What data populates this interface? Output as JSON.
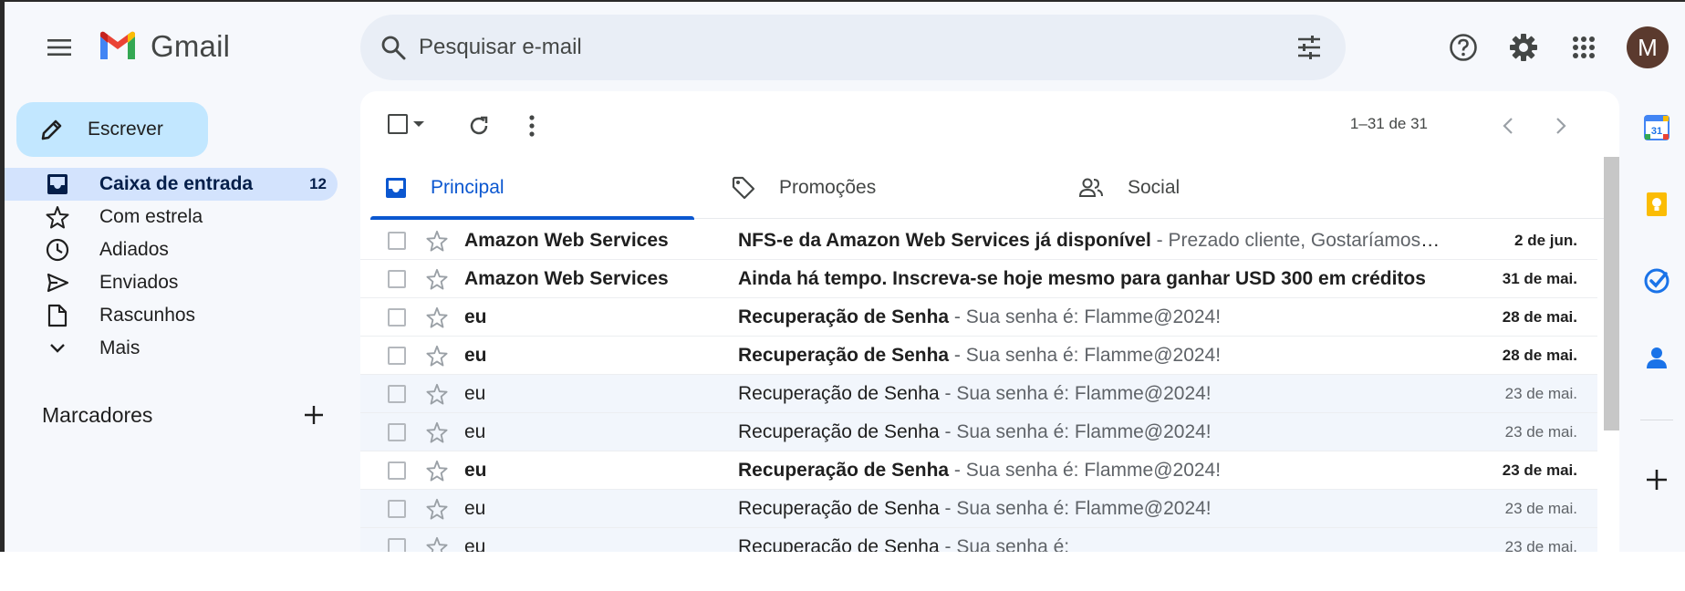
{
  "header": {
    "app_name": "Gmail",
    "search_placeholder": "Pesquisar e-mail",
    "avatar_letter": "M"
  },
  "sidebar": {
    "compose_label": "Escrever",
    "items": [
      {
        "label": "Caixa de entrada",
        "count": "12",
        "icon": "inbox-icon",
        "active": true
      },
      {
        "label": "Com estrela",
        "count": "",
        "icon": "star-outline-icon",
        "active": false
      },
      {
        "label": "Adiados",
        "count": "",
        "icon": "clock-icon",
        "active": false
      },
      {
        "label": "Enviados",
        "count": "",
        "icon": "send-icon",
        "active": false
      },
      {
        "label": "Rascunhos",
        "count": "",
        "icon": "draft-icon",
        "active": false
      },
      {
        "label": "Mais",
        "count": "",
        "icon": "chevron-down-icon",
        "active": false
      }
    ],
    "labels_header": "Marcadores"
  },
  "toolbar": {
    "pager_text": "1–31 de 31"
  },
  "tabs": [
    {
      "label": "Principal",
      "icon": "inbox-tab-icon",
      "active": true
    },
    {
      "label": "Promoções",
      "icon": "tag-icon",
      "active": false
    },
    {
      "label": "Social",
      "icon": "people-icon",
      "active": false
    }
  ],
  "emails": [
    {
      "sender": "Amazon Web Services",
      "subject": "NFS-e da Amazon Web Services já disponível",
      "snippet": " - Prezado cliente, Gostaríamos de informar que a NFS-e",
      "date": "2 de jun.",
      "unread": true
    },
    {
      "sender": "Amazon Web Services",
      "subject": "Ainda há tempo. Inscreva-se hoje mesmo para ganhar USD 300 em créditos",
      "snippet": "",
      "date": "31 de mai.",
      "unread": true
    },
    {
      "sender": "eu",
      "subject": "Recuperação de Senha",
      "snippet": " - Sua senha é: Flamme@2024!",
      "date": "28 de mai.",
      "unread": true
    },
    {
      "sender": "eu",
      "subject": "Recuperação de Senha",
      "snippet": " - Sua senha é: Flamme@2024!",
      "date": "28 de mai.",
      "unread": true
    },
    {
      "sender": "eu",
      "subject": "Recuperação de Senha",
      "snippet": " - Sua senha é: Flamme@2024!",
      "date": "23 de mai.",
      "unread": false
    },
    {
      "sender": "eu",
      "subject": "Recuperação de Senha",
      "snippet": " - Sua senha é: Flamme@2024!",
      "date": "23 de mai.",
      "unread": false
    },
    {
      "sender": "eu",
      "subject": "Recuperação de Senha",
      "snippet": " - Sua senha é: Flamme@2024!",
      "date": "23 de mai.",
      "unread": true
    },
    {
      "sender": "eu",
      "subject": "Recuperação de Senha",
      "snippet": " - Sua senha é: Flamme@2024!",
      "date": "23 de mai.",
      "unread": false
    },
    {
      "sender": "eu",
      "subject": "Recuperação de Senha",
      "snippet": " - Sua senha é:",
      "date": "23 de mai.",
      "unread": false
    }
  ],
  "rail": {
    "calendar_day": "31"
  },
  "colors": {
    "accent": "#0b57d0",
    "compose_bg": "#c2e7ff",
    "active_nav_bg": "#d3e3fd",
    "avatar_bg": "#5b3a2e"
  }
}
